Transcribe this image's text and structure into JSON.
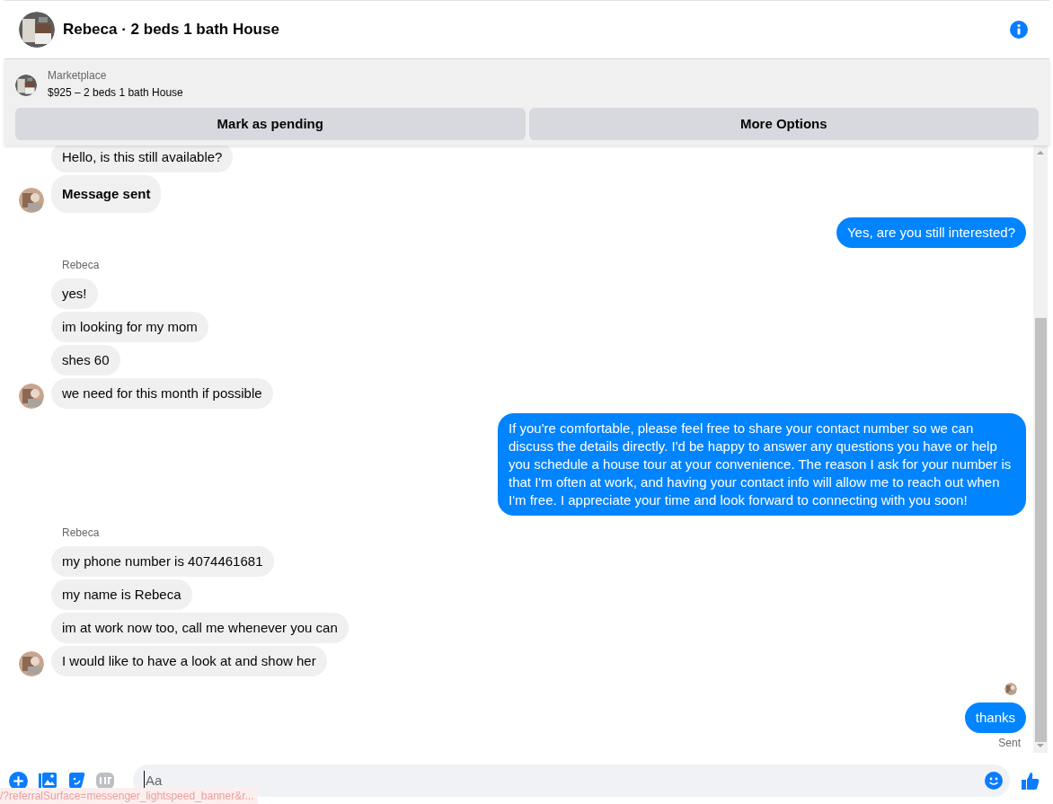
{
  "header": {
    "title": "Rebeca · 2 beds 1 bath House"
  },
  "listing": {
    "source": "Marketplace",
    "title": "$925 – 2 beds 1 bath House",
    "buttons": [
      "Mark as pending",
      "More Options"
    ]
  },
  "groups": [
    {
      "kind": "incoming",
      "messages": [
        {
          "text": "Hello, is this still available?",
          "bold": false
        },
        {
          "text": "Message sent",
          "bold": true
        }
      ]
    },
    {
      "kind": "outgoing",
      "messages": [
        {
          "text": "Yes, are you still interested?",
          "bold": false
        }
      ]
    },
    {
      "kind": "incoming",
      "sender": "Rebeca",
      "messages": [
        {
          "text": "yes!",
          "bold": false
        },
        {
          "text": "im looking for my mom",
          "bold": false
        },
        {
          "text": "shes 60",
          "bold": false
        },
        {
          "text": "we need for this month if possible",
          "bold": false
        }
      ]
    },
    {
      "kind": "outgoing",
      "messages": [
        {
          "text": "If you're comfortable, please feel free to share your contact number so we can discuss the details directly. I'd be happy to answer any questions you have or help you schedule a house tour at your convenience. The reason I ask for your number is that I'm often at work, and having your contact info will allow me to reach out when I'm free. I appreciate your time and look forward to connecting with you soon!",
          "bold": false
        }
      ]
    },
    {
      "kind": "incoming",
      "sender": "Rebeca",
      "messages": [
        {
          "text": "my phone number is 4074461681",
          "bold": false
        },
        {
          "text": "my name is Rebeca",
          "bold": false
        },
        {
          "text": "im at work now too, call me whenever you can",
          "bold": false
        },
        {
          "text": "I would like to have a look at and show her",
          "bold": false
        }
      ]
    },
    {
      "kind": "outgoing",
      "seen": true,
      "status": "Sent",
      "messages": [
        {
          "text": "thanks",
          "bold": false
        }
      ]
    }
  ],
  "composer": {
    "placeholder": "Aa"
  },
  "status_link": "/?referralSurface=messenger_lightspeed_banner&r..."
}
